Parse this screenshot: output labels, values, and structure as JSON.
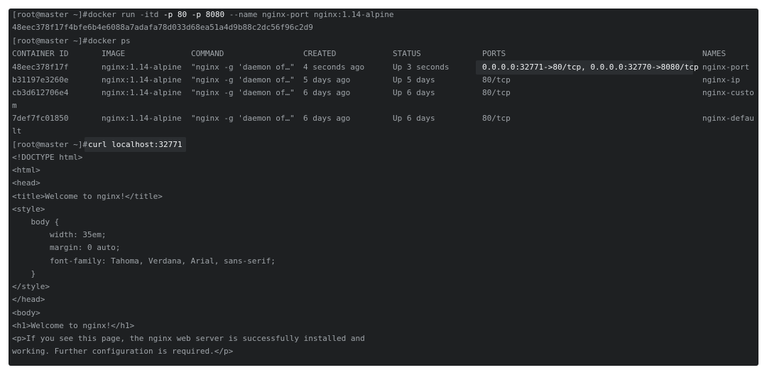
{
  "prompt": "[root@master ~]#",
  "cmd_run": {
    "prefix": "docker run -itd ",
    "flag1": "-p 80",
    "mid": " ",
    "flag2": "-p 8080",
    "suffix": " --name nginx-port nginx:1.14-alpine"
  },
  "container_hash": "48eec378f17f4bfe6b4e6088a7adafa78d033d68ea51a4d9b88c2dc56f96c2d9",
  "cmd_ps": "docker ps",
  "ps_table": {
    "headers": [
      "CONTAINER ID",
      "IMAGE",
      "COMMAND",
      "CREATED",
      "STATUS",
      "PORTS",
      "NAMES"
    ],
    "rows": [
      {
        "id": "48eec378f17f",
        "image": "nginx:1.14-alpine",
        "command": "\"nginx -g 'daemon of…\"",
        "created": "4 seconds ago",
        "status": "Up 3 seconds",
        "ports": "0.0.0.0:32771->80/tcp, 0.0.0.0:32770->8080/tcp",
        "names": "nginx-port",
        "names_wrap": ""
      },
      {
        "id": "b31197e3260e",
        "image": "nginx:1.14-alpine",
        "command": "\"nginx -g 'daemon of…\"",
        "created": "5 days ago",
        "status": "Up 5 days",
        "ports": "80/tcp",
        "names": "nginx-ip",
        "names_wrap": ""
      },
      {
        "id": "cb3d612706e4",
        "image": "nginx:1.14-alpine",
        "command": "\"nginx -g 'daemon of…\"",
        "created": "6 days ago",
        "status": "Up 6 days",
        "ports": "80/tcp",
        "names": "nginx-custo",
        "names_wrap": "m"
      },
      {
        "id": "7def7fc01850",
        "image": "nginx:1.14-alpine",
        "command": "\"nginx -g 'daemon of…\"",
        "created": "6 days ago",
        "status": "Up 6 days",
        "ports": "80/tcp",
        "names": "nginx-defau",
        "names_wrap": "lt"
      }
    ]
  },
  "cmd_curl": "curl localhost:32771",
  "html_output": [
    "<!DOCTYPE html>",
    "<html>",
    "<head>",
    "<title>Welcome to nginx!</title>",
    "<style>",
    "    body {",
    "        width: 35em;",
    "        margin: 0 auto;",
    "        font-family: Tahoma, Verdana, Arial, sans-serif;",
    "    }",
    "</style>",
    "</head>",
    "<body>",
    "<h1>Welcome to nginx!</h1>",
    "<p>If you see this page, the nginx web server is successfully installed and",
    "working. Further configuration is required.</p>"
  ],
  "colors": {
    "background": "#1e2022",
    "text": "#9ea3a8",
    "highlight_text": "#f0f2f4",
    "highlight_box": "#2b2e31"
  }
}
